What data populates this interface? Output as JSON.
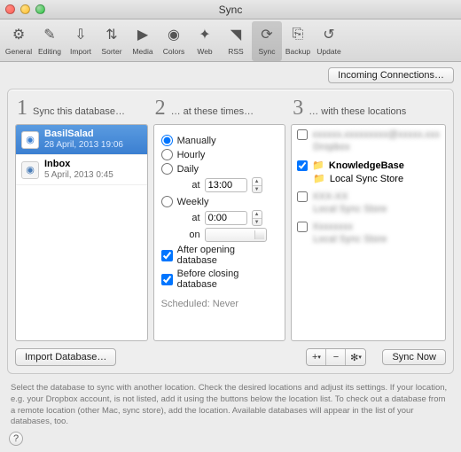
{
  "window": {
    "title": "Sync"
  },
  "toolbar": {
    "items": [
      {
        "label": "General",
        "icon": "⚙"
      },
      {
        "label": "Editing",
        "icon": "✎"
      },
      {
        "label": "Import",
        "icon": "⇩"
      },
      {
        "label": "Sorter",
        "icon": "⇅"
      },
      {
        "label": "Media",
        "icon": "▶"
      },
      {
        "label": "Colors",
        "icon": "◉"
      },
      {
        "label": "Web",
        "icon": "✦"
      },
      {
        "label": "RSS",
        "icon": "◥"
      },
      {
        "label": "Sync",
        "icon": "⟳"
      },
      {
        "label": "Backup",
        "icon": "⎘"
      },
      {
        "label": "Update",
        "icon": "↺"
      }
    ],
    "selected": 8
  },
  "buttons": {
    "incoming": "Incoming Connections…",
    "import_db": "Import Database…",
    "sync_now": "Sync Now"
  },
  "columns": {
    "c1": "Sync this database…",
    "c2": "… at these times…",
    "c3": "… with these locations"
  },
  "databases": [
    {
      "name": "BasilSalad",
      "sub": "28 April, 2013 19:06",
      "selected": true
    },
    {
      "name": "Inbox",
      "sub": "5 April, 2013 0:45",
      "selected": false
    }
  ],
  "schedule": {
    "manually": "Manually",
    "hourly": "Hourly",
    "daily": "Daily",
    "weekly": "Weekly",
    "at": "at",
    "on": "on",
    "daily_time": "13:00",
    "weekly_time": "0:00",
    "after_open": "After opening database",
    "before_close": "Before closing database",
    "scheduled_label": "Scheduled:",
    "scheduled_value": "Never",
    "selected": "manually",
    "after_open_checked": true,
    "before_close_checked": true
  },
  "locations": {
    "knowledgebase": {
      "label": "KnowledgeBase",
      "checked": true,
      "sub": "Local Sync Store"
    }
  },
  "help_text": "Select the database to sync with another location. Check the desired locations and adjust its settings. If your location, e.g. your Dropbox account, is not listed, add it using the buttons below the location list. To check out a database from a remote location (other Mac, sync store), add the location. Available databases will appear in the list of your databases, too."
}
